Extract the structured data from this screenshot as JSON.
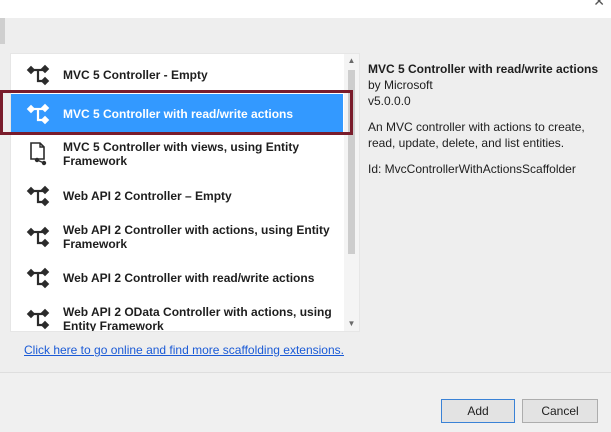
{
  "window": {
    "close_glyph": "✕"
  },
  "templates": [
    {
      "label": "MVC 5 Controller - Empty",
      "icon": "controller-icon",
      "selected": false
    },
    {
      "label": "MVC 5 Controller with read/write actions",
      "icon": "controller-icon",
      "selected": true
    },
    {
      "label": "MVC 5 Controller with views, using Entity Framework",
      "icon": "controller-views-icon",
      "selected": false
    },
    {
      "label": "Web API 2 Controller – Empty",
      "icon": "controller-icon",
      "selected": false
    },
    {
      "label": "Web API 2 Controller with actions, using Entity Framework",
      "icon": "controller-icon",
      "selected": false
    },
    {
      "label": "Web API 2 Controller with read/write actions",
      "icon": "controller-icon",
      "selected": false
    },
    {
      "label": "Web API 2 OData Controller with actions, using Entity Framework",
      "icon": "controller-icon",
      "selected": false
    }
  ],
  "details": {
    "title": "MVC 5 Controller with read/write actions",
    "author": "by Microsoft",
    "version": "v5.0.0.0",
    "description": "An MVC controller with actions to create, read, update, delete, and list entities.",
    "id": "Id: MvcControllerWithActionsScaffolder"
  },
  "link": {
    "text": "Click here to go online and find more scaffolding extensions."
  },
  "buttons": {
    "add": "Add",
    "cancel": "Cancel"
  },
  "colors": {
    "selection": "#3399ff",
    "highlight_frame": "#7a1c2b",
    "link": "#1a5ad6"
  },
  "scrollbar": {
    "up": "▲",
    "down": "▼"
  }
}
